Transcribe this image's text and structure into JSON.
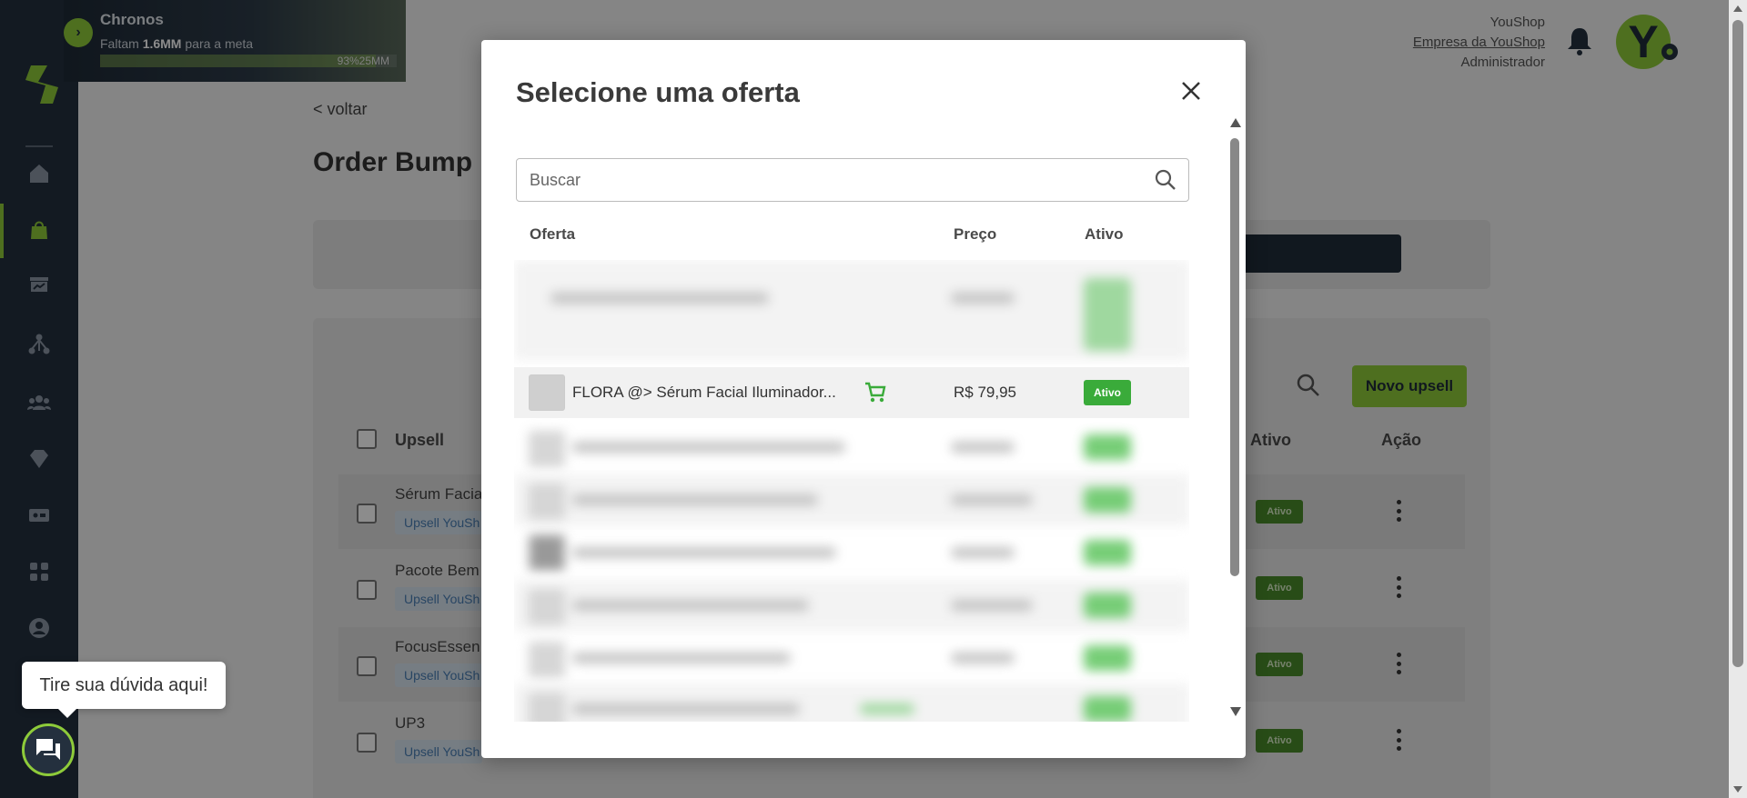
{
  "goal_banner": {
    "title": "Chronos",
    "subtitle_prefix": "Faltam ",
    "subtitle_amount": "1.6MM",
    "subtitle_suffix": " para a meta",
    "progress_text": "93%25MM"
  },
  "background": {
    "back_link": "< voltar",
    "page_title": "Order Bump",
    "new_upsell_label": "Novo upsell",
    "columns": {
      "upsell": "Upsell",
      "ativo": "Ativo",
      "acao": "Ação"
    },
    "rows": [
      {
        "name": "Sérum Facia",
        "tag": "Upsell YouSh",
        "status": "Ativo"
      },
      {
        "name": "Pacote Bem",
        "tag": "Upsell YouSh",
        "status": "Ativo"
      },
      {
        "name": "FocusEssen",
        "tag": "Upsell YouSh",
        "status": "Ativo"
      },
      {
        "name": "UP3",
        "tag": "Upsell YouSh",
        "status": "Ativo"
      }
    ]
  },
  "user": {
    "name": "YouShop",
    "company": "Empresa da YouShop",
    "role": "Administrador",
    "avatar_letter": "Y"
  },
  "help": {
    "bubble_text": "Tire sua dúvida aqui!"
  },
  "modal": {
    "title": "Selecione uma oferta",
    "search_placeholder": "Buscar",
    "columns": {
      "offer": "Oferta",
      "price": "Preço",
      "active": "Ativo"
    },
    "highlighted_offer": {
      "name": "FLORA @> Sérum Facial Iluminador...",
      "price": "R$ 79,95",
      "status": "Ativo"
    }
  },
  "colors": {
    "sidebar": "#24303e",
    "accent_green": "#8ecb3a",
    "badge_green": "#3aab3a"
  }
}
